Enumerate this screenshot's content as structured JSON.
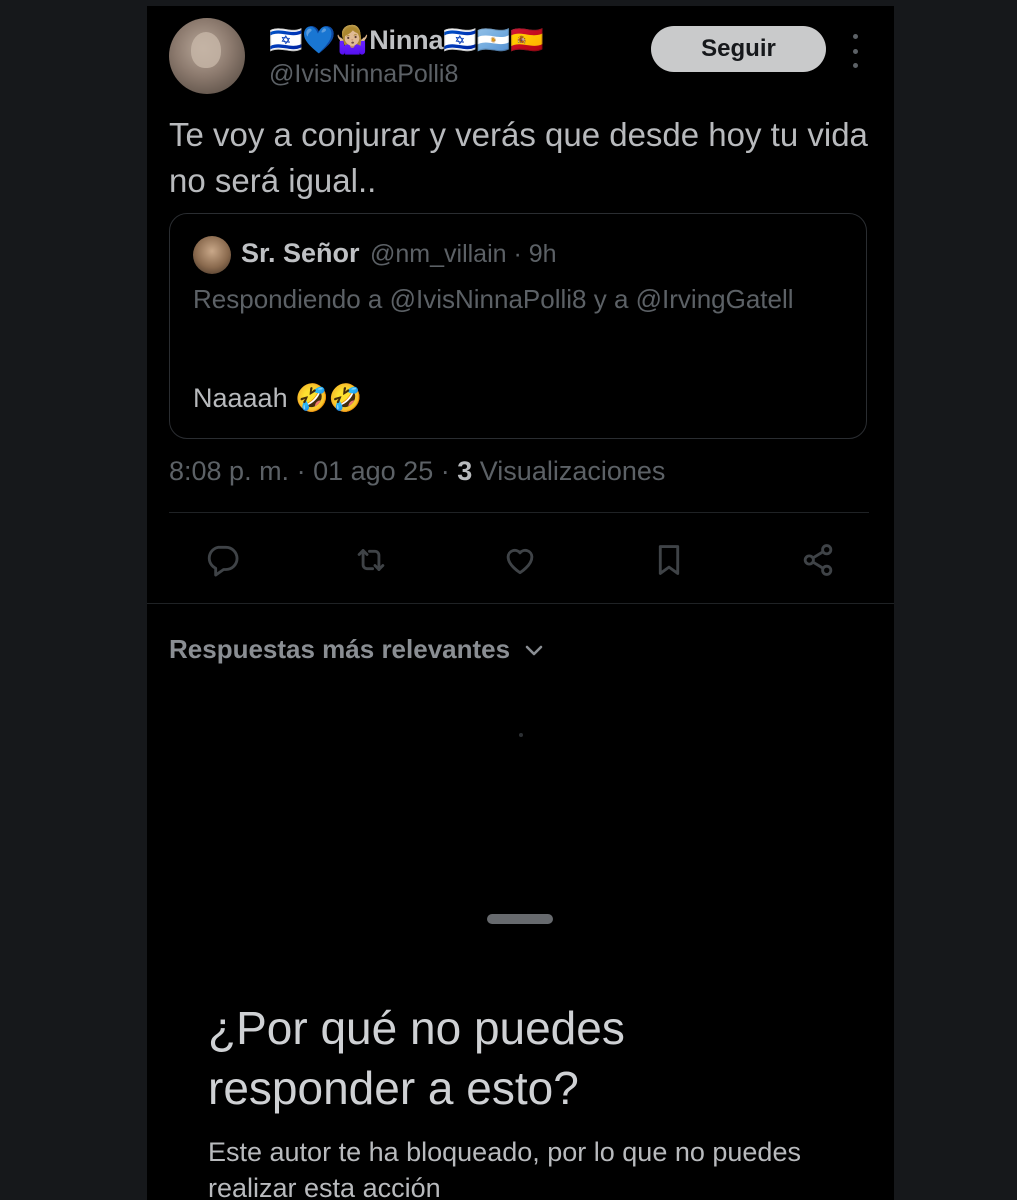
{
  "tweet": {
    "display_name": "🇮🇱💙🤷🏼‍♀️Ninna🇮🇱🇦🇷🇪🇸",
    "handle": "@IvisNinnaPolli8",
    "follow_label": "Seguir",
    "text": "Te voy a conjurar y verás que desde hoy tu vida no será igual..",
    "time": "8:08 p. m.",
    "date": "01 ago 25",
    "views_count": "3",
    "views_label": "Visualizaciones"
  },
  "quoted": {
    "name": "Sr. Señor",
    "handle": "@nm_villain",
    "age": "9h",
    "replying_to": "Respondiendo a @IvisNinnaPolli8 y a @IrvingGatell",
    "text": "Naaaah 🤣🤣"
  },
  "actions": {
    "icons": [
      "reply-icon",
      "retweet-icon",
      "like-icon",
      "bookmark-icon",
      "share-icon"
    ]
  },
  "replies": {
    "sort_label": "Respuestas más relevantes"
  },
  "sheet": {
    "title": "¿Por qué no puedes responder a esto?",
    "body": "Este autor te ha bloqueado, por lo que no puedes realizar esta acción"
  },
  "colors": {
    "background": "#000000",
    "outer_background": "#16181b",
    "muted_text": "#5c6166",
    "primary_text": "#b8babd",
    "follow_button": "#c9cacb"
  }
}
